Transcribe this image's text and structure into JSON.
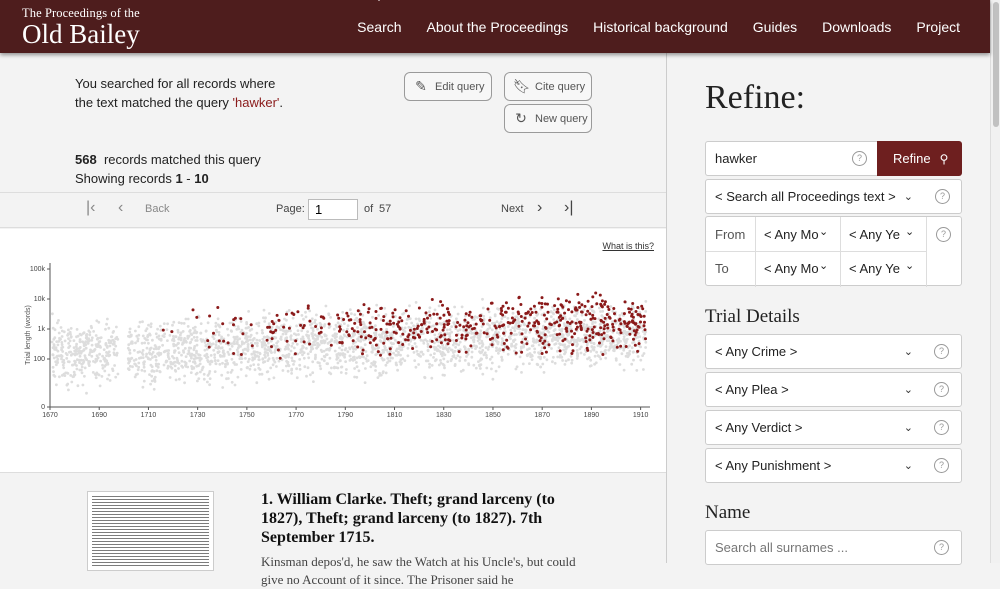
{
  "header": {
    "logo_small": "The Proceedings of the",
    "logo_big": "Old Bailey",
    "nav": [
      "Search",
      "About the Proceedings",
      "Historical background",
      "Guides",
      "Downloads",
      "Project"
    ]
  },
  "summary": {
    "line1": "You searched for all records where",
    "line2_prefix": "the text matched the query ",
    "query": "'hawker'",
    "line2_suffix": "."
  },
  "buttons": {
    "edit": "Edit query",
    "cite": "Cite query",
    "new": "New query"
  },
  "counts": {
    "total": "568",
    "total_suffix": "records matched this query",
    "showing_prefix": "Showing records ",
    "from": "1",
    "sep": " - ",
    "to": "10"
  },
  "pager": {
    "back": "Back",
    "page_label": "Page:",
    "page_value": "1",
    "of_label": "of",
    "total_pages": "57",
    "next": "Next"
  },
  "chart_link": "What is this?",
  "chart_data": {
    "type": "scatter",
    "title": "",
    "xlabel": "",
    "ylabel": "Trial length (words)",
    "x_ticks": [
      "1670",
      "1690",
      "1710",
      "1730",
      "1750",
      "1770",
      "1790",
      "1810",
      "1830",
      "1850",
      "1870",
      "1890",
      "1910"
    ],
    "y_ticks": [
      "100k",
      "10k",
      "1k",
      "100",
      "0"
    ],
    "xlim": [
      1670,
      1913
    ],
    "y_scale": "log",
    "series": [
      {
        "color": "#dddddd",
        "density": "background, all trials"
      },
      {
        "color": "#8b1a1a",
        "density": "matching trials"
      }
    ]
  },
  "result": {
    "title": "1. William Clarke. Theft; grand larceny (to 1827), Theft; grand larceny (to 1827). 7th September 1715.",
    "text": "Kinsman depos'd, he saw the Watch at his Uncle's, but could give no Account of it since. The Prisoner said he"
  },
  "refine": {
    "heading": "Refine:",
    "search_value": "hawker",
    "refine_button": "Refine",
    "scope": "< Search all Proceedings text >",
    "from_label": "From",
    "to_label": "To",
    "any_month": "< Any Mo",
    "any_year": "< Any Ye",
    "trial_heading": "Trial Details",
    "crime": "< Any Crime >",
    "plea": "< Any Plea >",
    "verdict": "< Any Verdict >",
    "punishment": "< Any Punishment >",
    "name_heading": "Name",
    "surname_placeholder": "Search all surnames ..."
  },
  "colors": {
    "header_bg": "#4e1d1d",
    "accent": "#6e1f1f",
    "query": "#8a1a1a",
    "match_points": "#8b1a1a"
  }
}
